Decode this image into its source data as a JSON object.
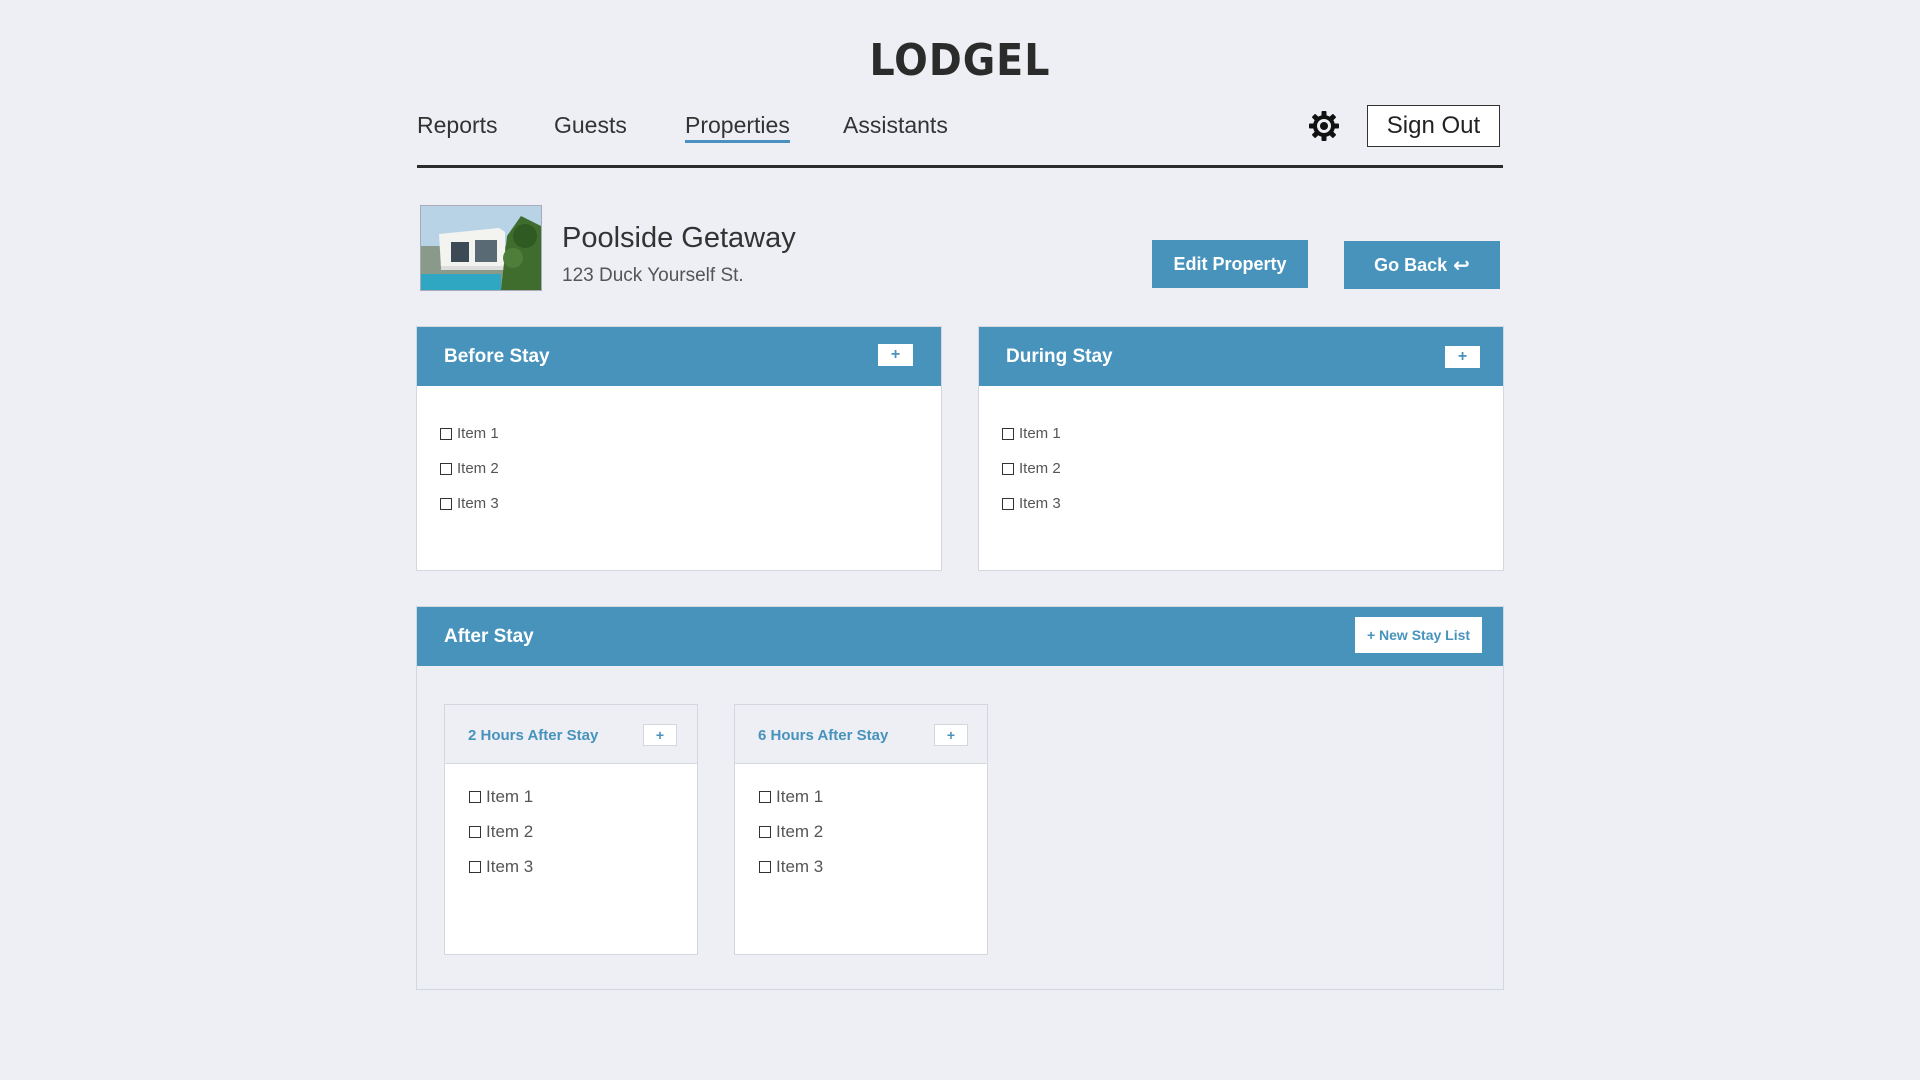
{
  "brand": "LODGEL",
  "nav": {
    "items": [
      "Reports",
      "Guests",
      "Properties",
      "Assistants"
    ],
    "active": "Properties",
    "sign_out": "Sign Out",
    "settings_icon": "gear-icon"
  },
  "property": {
    "name": "Poolside Getaway",
    "address": "123 Duck Yourself St.",
    "edit_label": "Edit Property",
    "back_label": "Go Back",
    "back_icon": "return-arrow-icon"
  },
  "before_stay": {
    "title": "Before Stay",
    "add_label": "+",
    "items": [
      "Item 1",
      "Item 2",
      "Item 3"
    ]
  },
  "during_stay": {
    "title": "During Stay",
    "add_label": "+",
    "items": [
      "Item 1",
      "Item 2",
      "Item 3"
    ]
  },
  "after_stay": {
    "title": "After Stay",
    "new_list_label": "+ New Stay List",
    "lists": [
      {
        "title": "2 Hours After Stay",
        "add_label": "+",
        "items": [
          "Item 1",
          "Item 2",
          "Item 3"
        ]
      },
      {
        "title": "6 Hours After Stay",
        "add_label": "+",
        "items": [
          "Item 1",
          "Item 2",
          "Item 3"
        ]
      }
    ]
  },
  "colors": {
    "accent": "#4793bc",
    "background": "#edeff4",
    "text": "#333333"
  }
}
